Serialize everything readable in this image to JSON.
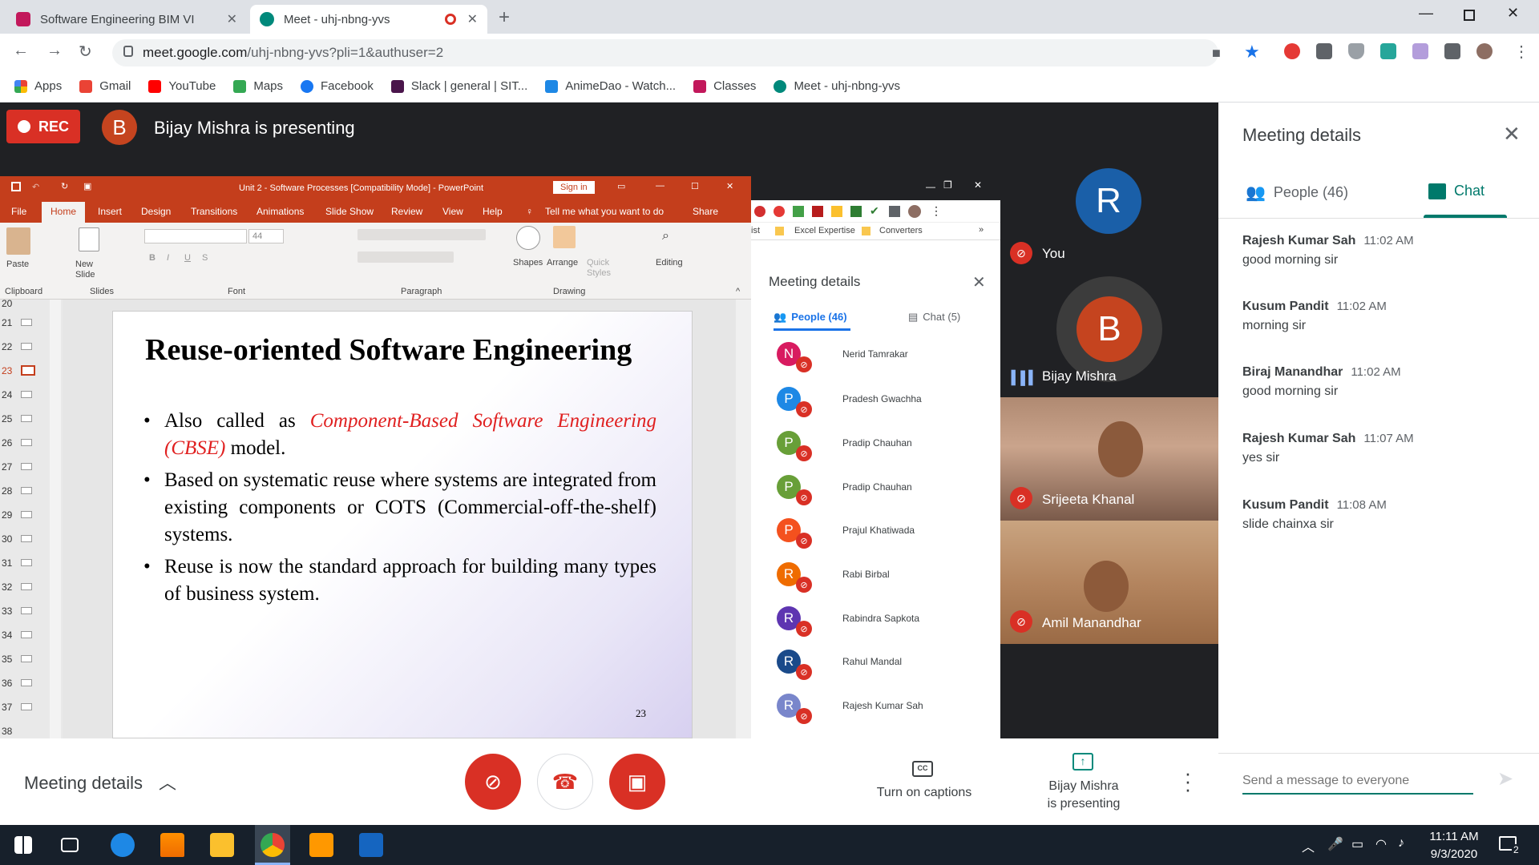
{
  "tabs": [
    {
      "title": "Software Engineering BIM VI",
      "active": false
    },
    {
      "title": "Meet - uhj-nbng-yvs",
      "active": true
    }
  ],
  "url": {
    "host": "meet.google.com",
    "path": "/uhj-nbng-yvs?pli=1&authuser=2"
  },
  "bookmarks": [
    "Apps",
    "Gmail",
    "YouTube",
    "Maps",
    "Facebook",
    "Slack | general | SIT...",
    "AnimeDao - Watch...",
    "Classes",
    "Meet - uhj-nbng-yvs"
  ],
  "meet": {
    "rec_label": "REC",
    "presenter_initial": "B",
    "presenting_title": "Bijay Mishra is presenting"
  },
  "powerpoint": {
    "window_title": "Unit 2 - Software Processes [Compatibility Mode] - PowerPoint",
    "sign_in": "Sign in",
    "tabs": [
      "File",
      "Home",
      "Insert",
      "Design",
      "Transitions",
      "Animations",
      "Slide Show",
      "Review",
      "View",
      "Help"
    ],
    "tell_me": "Tell me what you want to do",
    "share": "Share",
    "groups": [
      "Clipboard",
      "Slides",
      "Font",
      "Paragraph",
      "Drawing"
    ],
    "buttons": {
      "paste": "Paste",
      "new_slide": "New Slide",
      "shapes": "Shapes",
      "arrange": "Arrange",
      "quick_styles": "Quick Styles",
      "editing": "Editing"
    },
    "font_size": "44",
    "thumb_numbers": [
      "20",
      "21",
      "22",
      "23",
      "24",
      "25",
      "26",
      "27",
      "28",
      "29",
      "30",
      "31",
      "32",
      "33",
      "34",
      "35",
      "36",
      "37",
      "38"
    ],
    "slide": {
      "title": "Reuse-oriented Software Engineering",
      "b1_pre": "Also called as ",
      "b1_red": "Component-Based Software Engineering (CBSE)",
      "b1_post": " model.",
      "b2": "Based on systematic reuse where systems are integrated from existing components or COTS (Commercial-off-the-shelf) systems.",
      "b3": "Reuse is now the standard approach for building many types of business system.",
      "number": "23"
    }
  },
  "inner_meet": {
    "bookmarks": [
      "ist",
      "Excel Expertise",
      "Converters"
    ],
    "title": "Meeting details",
    "people_tab": "People (46)",
    "chat_tab": "Chat (5)",
    "people": [
      {
        "initial": "N",
        "name": "Nerid Tamrakar",
        "color": "#d81b60"
      },
      {
        "initial": "P",
        "name": "Pradesh Gwachha",
        "color": "#1e88e5"
      },
      {
        "initial": "P",
        "name": "Pradip Chauhan",
        "color": "#689f38"
      },
      {
        "initial": "P",
        "name": "Pradip Chauhan",
        "color": "#689f38"
      },
      {
        "initial": "P",
        "name": "Prajul Khatiwada",
        "color": "#f4511e"
      },
      {
        "initial": "R",
        "name": "Rabi Birbal",
        "color": "#ef6c00"
      },
      {
        "initial": "R",
        "name": "Rabindra Sapkota",
        "color": "#5e35b1"
      },
      {
        "initial": "R",
        "name": "Rahul Mandal",
        "color": "#1a4a8a"
      },
      {
        "initial": "R",
        "name": "Rajesh Kumar Sah",
        "color": "#7986cb"
      }
    ]
  },
  "participants": [
    {
      "initial": "R",
      "name": "You",
      "color": "#1a5fa8"
    },
    {
      "initial": "B",
      "name": "Bijay Mishra",
      "color": "#c5441f"
    },
    {
      "name": "Srijeeta Khanal"
    },
    {
      "name": "Amil Manandhar"
    }
  ],
  "controls": {
    "meeting_details": "Meeting details",
    "captions_label": "Turn on captions",
    "captions_icon": "CC",
    "presenting_line1": "Bijay Mishra",
    "presenting_line2": "is presenting"
  },
  "panel": {
    "title": "Meeting details",
    "people_tab": "People (46)",
    "chat_tab": "Chat",
    "messages": [
      {
        "sender": "Rajesh Kumar Sah",
        "time": "11:02 AM",
        "text": "good morning sir"
      },
      {
        "sender": "Kusum Pandit",
        "time": "11:02 AM",
        "text": "morning sir"
      },
      {
        "sender": "Biraj Manandhar",
        "time": "11:02 AM",
        "text": "good morning sir"
      },
      {
        "sender": "Rajesh Kumar Sah",
        "time": "11:07 AM",
        "text": "yes sir"
      },
      {
        "sender": "Kusum Pandit",
        "time": "11:08 AM",
        "text": "slide chainxa sir"
      }
    ],
    "input_placeholder": "Send a message to everyone"
  },
  "taskbar": {
    "time": "11:11 AM",
    "date": "9/3/2020",
    "notifications": "2"
  },
  "colors": {
    "meet_red": "#d93025",
    "chat_green": "#00796b",
    "ppt_orange": "#c43e1c"
  }
}
